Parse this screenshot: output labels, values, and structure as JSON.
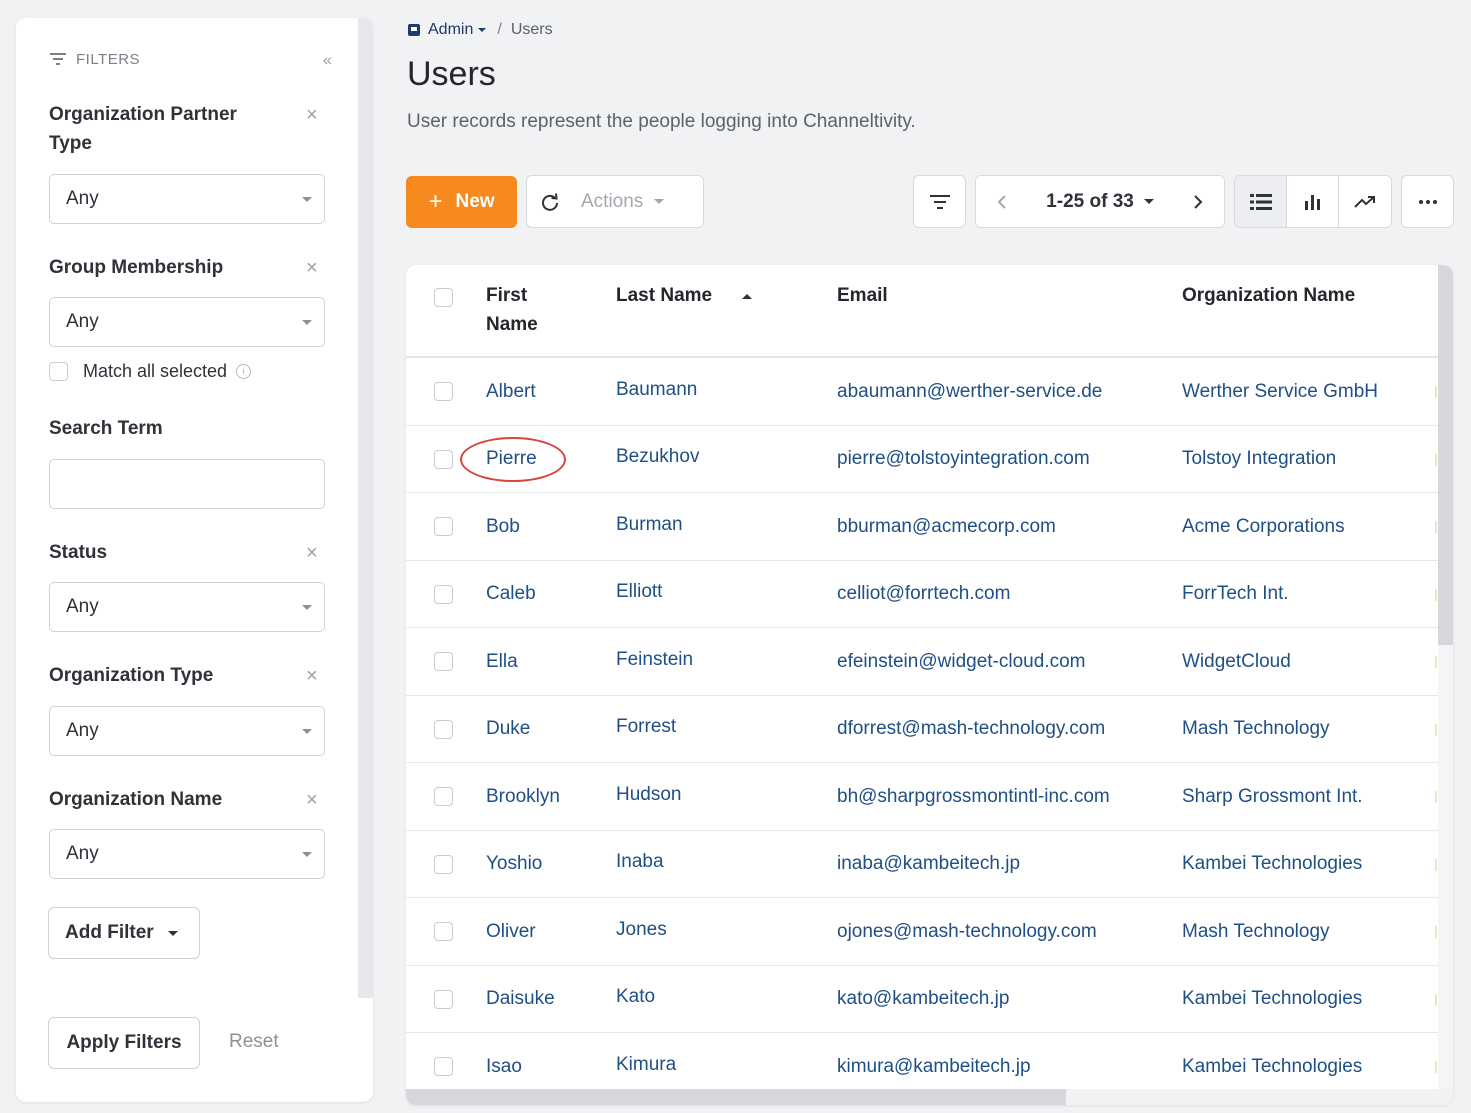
{
  "sidebar": {
    "title": "FILTERS",
    "filters": [
      {
        "label": "Organization Partner Type",
        "value": "Any"
      },
      {
        "label": "Group Membership",
        "value": "Any"
      },
      {
        "label": "Status",
        "value": "Any"
      },
      {
        "label": "Organization Type",
        "value": "Any"
      },
      {
        "label": "Organization Name",
        "value": "Any"
      }
    ],
    "match_all_label": "Match all selected",
    "search_term_label": "Search Term",
    "search_term_value": "",
    "add_filter_label": "Add Filter",
    "apply_label": "Apply Filters",
    "reset_label": "Reset"
  },
  "breadcrumb": {
    "parent": "Admin",
    "separator": "/",
    "current": "Users"
  },
  "page": {
    "title": "Users",
    "description": "User records represent the people logging into Channeltivity."
  },
  "toolbar": {
    "new_label": "New",
    "actions_label": "Actions",
    "range_label": "1-25 of 33"
  },
  "table": {
    "columns": [
      "First Name",
      "Last Name",
      "Email",
      "Organization Name"
    ],
    "sorted_column": "Last Name",
    "rows": [
      {
        "first": "Albert",
        "last": "Baumann",
        "email": "abaumann@werther-service.de",
        "org": "Werther Service GmbH"
      },
      {
        "first": "Pierre",
        "last": "Bezukhov",
        "email": "pierre@tolstoyintegration.com",
        "org": "Tolstoy Integration"
      },
      {
        "first": "Bob",
        "last": "Burman",
        "email": "bburman@acmecorp.com",
        "org": "Acme Corporations"
      },
      {
        "first": "Caleb",
        "last": "Elliott",
        "email": "celliot@forrtech.com",
        "org": "ForrTech Int."
      },
      {
        "first": "Ella",
        "last": "Feinstein",
        "email": "efeinstein@widget-cloud.com",
        "org": "WidgetCloud"
      },
      {
        "first": "Duke",
        "last": "Forrest",
        "email": "dforrest@mash-technology.com",
        "org": "Mash Technology"
      },
      {
        "first": "Brooklyn",
        "last": "Hudson",
        "email": "bh@sharpgrossmontintl-inc.com",
        "org": "Sharp Grossmont Int."
      },
      {
        "first": "Yoshio",
        "last": "Inaba",
        "email": "inaba@kambeitech.jp",
        "org": "Kambei Technologies"
      },
      {
        "first": "Oliver",
        "last": "Jones",
        "email": "ojones@mash-technology.com",
        "org": "Mash Technology"
      },
      {
        "first": "Daisuke",
        "last": "Kato",
        "email": "kato@kambeitech.jp",
        "org": "Kambei Technologies"
      },
      {
        "first": "Isao",
        "last": "Kimura",
        "email": "kimura@kambeitech.jp",
        "org": "Kambei Technologies"
      }
    ]
  },
  "colors": {
    "accent": "#f68a1f",
    "link": "#1f4f84",
    "annotation": "#d8453b"
  }
}
